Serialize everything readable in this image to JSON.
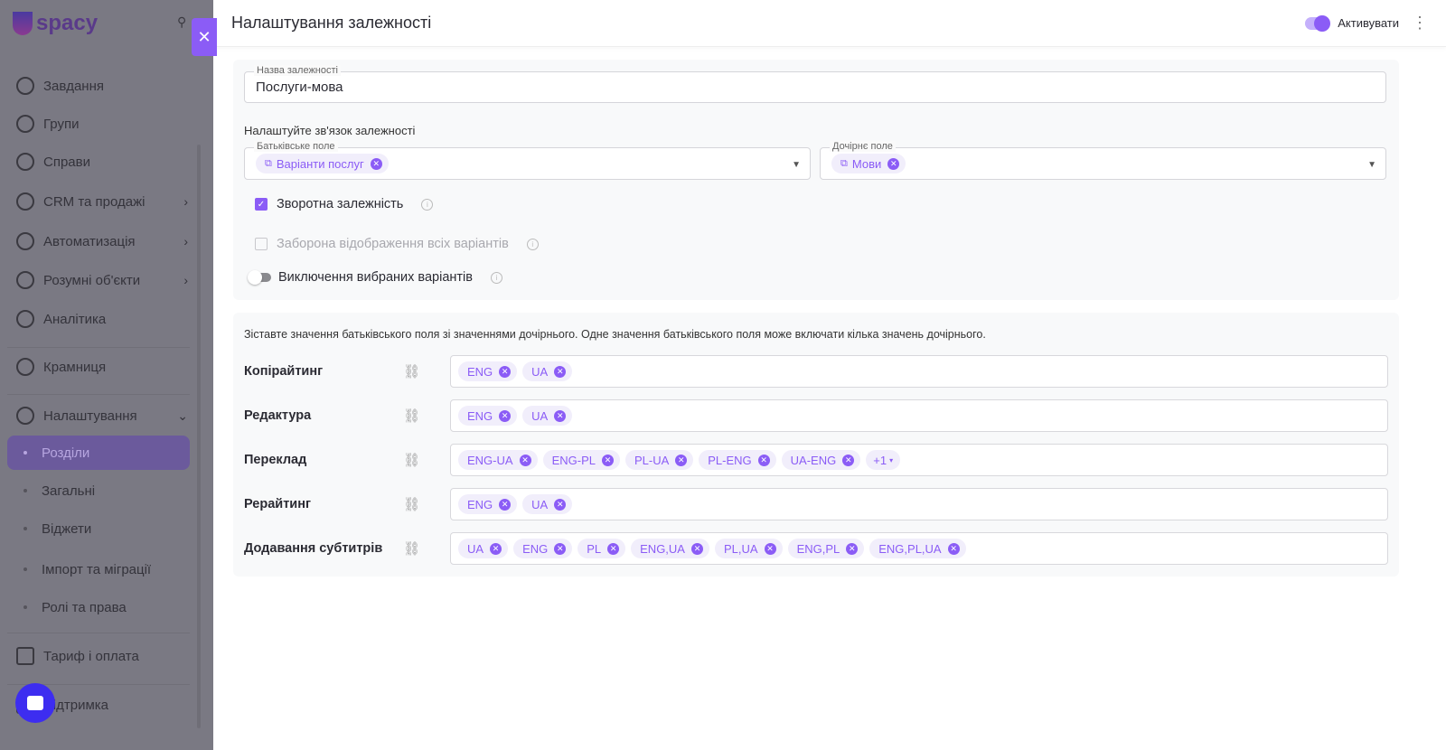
{
  "sidebar": {
    "logo": "spacy",
    "items": [
      {
        "label": "Завдання",
        "icon": "check-circle-icon"
      },
      {
        "label": "Групи",
        "icon": "users-icon"
      },
      {
        "label": "Справи",
        "icon": "calendar-icon"
      },
      {
        "label": "CRM та продажі",
        "icon": "database-icon",
        "chevron": "›"
      },
      {
        "label": "Автоматизація",
        "icon": "lightning-icon",
        "chevron": "›"
      },
      {
        "label": "Розумні об'єкти",
        "icon": "smart-object-icon",
        "chevron": "›"
      },
      {
        "label": "Аналітика",
        "icon": "analytics-icon"
      },
      {
        "label": "Крамниця",
        "icon": "store-icon"
      },
      {
        "label": "Налаштування",
        "icon": "gear-icon",
        "chevron": "⌄"
      }
    ],
    "sub_items": [
      "Розділи",
      "Загальні",
      "Віджети",
      "Імпорт та міграції",
      "Ролі та права"
    ],
    "active_sub": "Розділи",
    "bottom": [
      {
        "label": "Тариф і оплата",
        "icon": "wallet-icon"
      },
      {
        "label": "Підтримка",
        "icon": "support-icon"
      }
    ]
  },
  "panel": {
    "title": "Налаштування залежності",
    "activate_label": "Активувати",
    "activate_on": true,
    "name_legend": "Назва залежності",
    "name_value": "Послуги-мова",
    "relation_label": "Налаштуйте зв'язок залежності",
    "parent_legend": "Батьківське поле",
    "parent_value": "Варіанти послуг",
    "child_legend": "Дочірнє поле",
    "child_value": "Мови",
    "options": [
      {
        "label": "Зворотна залежність",
        "checked": true
      },
      {
        "label": "Заборона відображення всіх варіантів",
        "checked": false,
        "disabled": true
      },
      {
        "label": "Виключення вибраних варіантів",
        "toggle": false
      }
    ],
    "mapping_hint": "Зіставте значення батьківського поля зі значеннями дочірнього. Одне значення батьківського поля може включати кілька значень дочірнього.",
    "mappings": [
      {
        "parent": "Копірайтинг",
        "children": [
          "ENG",
          "UA"
        ]
      },
      {
        "parent": "Редактура",
        "children": [
          "ENG",
          "UA"
        ]
      },
      {
        "parent": "Переклад",
        "children": [
          "ENG-UA",
          "ENG-PL",
          "PL-UA",
          "PL-ENG",
          "UA-ENG"
        ],
        "more": "+1"
      },
      {
        "parent": "Рерайтинг",
        "children": [
          "ENG",
          "UA"
        ]
      },
      {
        "parent": "Додавання субтитрів",
        "children": [
          "UA",
          "ENG",
          "PL",
          "ENG,UA",
          "PL,UA",
          "ENG,PL",
          "ENG,PL,UA"
        ]
      }
    ]
  },
  "colors": {
    "accent": "#8b5cf6",
    "chat": "#3d2df0"
  }
}
